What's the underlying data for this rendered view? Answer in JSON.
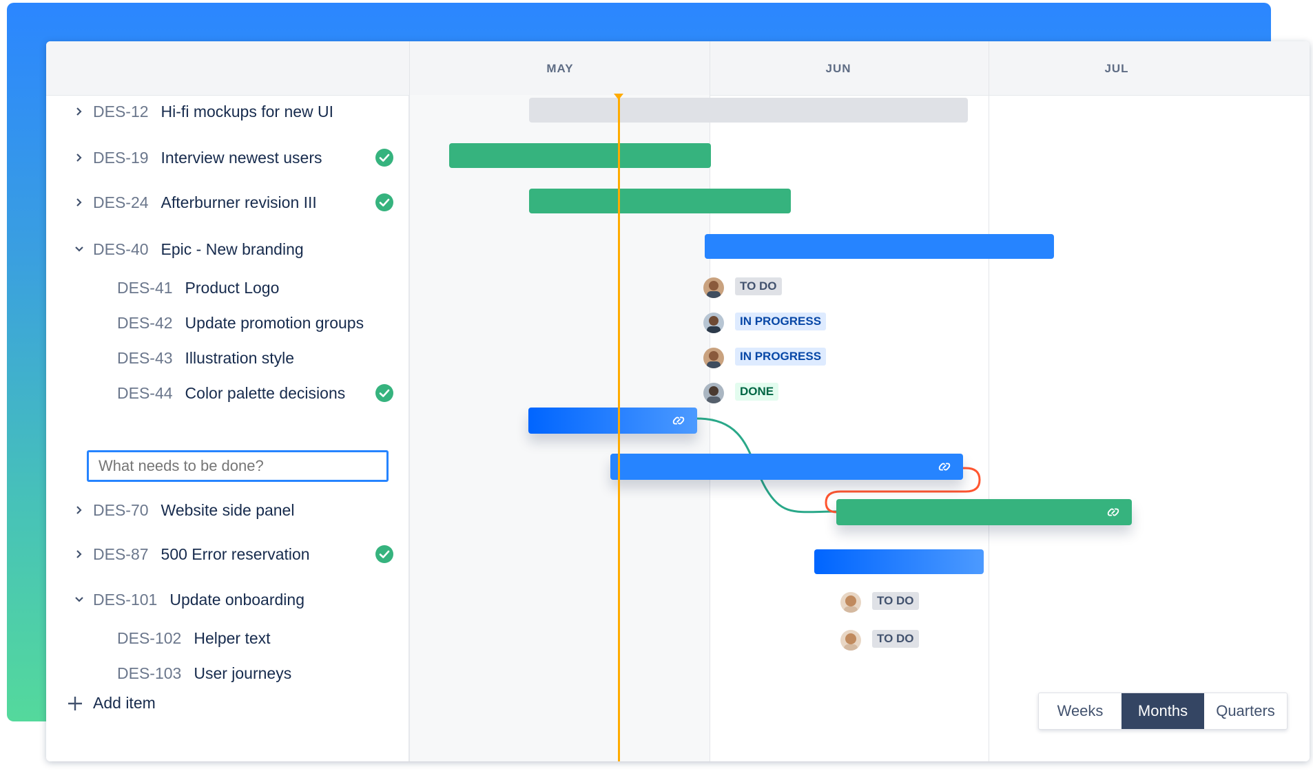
{
  "timeline": {
    "months": [
      "MAY",
      "JUN",
      "JUL"
    ]
  },
  "rows": [
    {
      "key": "DES-12",
      "title": "Hi-fi mockups for new UI",
      "chevron": "right",
      "done": false
    },
    {
      "key": "DES-19",
      "title": "Interview newest users",
      "chevron": "right",
      "done": true
    },
    {
      "key": "DES-24",
      "title": "Afterburner revision III",
      "chevron": "right",
      "done": true
    },
    {
      "key": "DES-40",
      "title": "Epic - New branding",
      "chevron": "down",
      "done": false
    },
    {
      "key": "DES-41",
      "title": "Product Logo",
      "status": "TO DO"
    },
    {
      "key": "DES-42",
      "title": "Update promotion groups",
      "status": "IN PROGRESS"
    },
    {
      "key": "DES-43",
      "title": "Illustration style",
      "status": "IN PROGRESS"
    },
    {
      "key": "DES-44",
      "title": "Color palette decisions",
      "status": "DONE",
      "done": true
    },
    {
      "key": "DES-70",
      "title": "Website side panel",
      "chevron": "right",
      "done": false
    },
    {
      "key": "DES-87",
      "title": "500 Error reservation",
      "chevron": "right",
      "done": true
    },
    {
      "key": "DES-101",
      "title": "Update onboarding",
      "chevron": "down",
      "done": false
    },
    {
      "key": "DES-102",
      "title": "Helper text",
      "status": "TO DO"
    },
    {
      "key": "DES-103",
      "title": "User journeys",
      "status": "TO DO"
    }
  ],
  "new_item": {
    "placeholder": "What needs to be done?"
  },
  "add_item": {
    "label": "Add item"
  },
  "view_toggle": {
    "options": [
      "Weeks",
      "Months",
      "Quarters"
    ],
    "selected": "Months"
  },
  "colors": {
    "accent": "#2684ff",
    "green": "#36b37e",
    "today": "#ffab00",
    "link_teal": "#2aa889",
    "link_red": "#ff5630"
  }
}
